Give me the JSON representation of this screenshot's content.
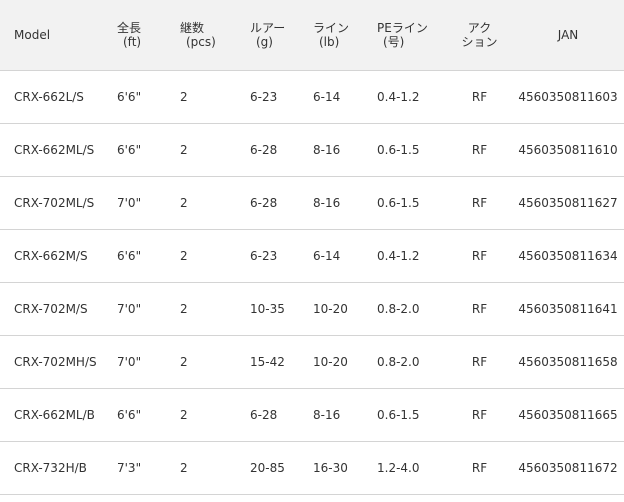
{
  "table": {
    "headers": [
      {
        "line1": "Model",
        "line2": ""
      },
      {
        "line1": "全長",
        "line2": "(ft)"
      },
      {
        "line1": "継数",
        "line2": "(pcs)"
      },
      {
        "line1": "ルアー",
        "line2": "(g)"
      },
      {
        "line1": "ライン",
        "line2": "(lb)"
      },
      {
        "line1": "PEライン",
        "line2": "(号)"
      },
      {
        "line1": "アク",
        "line2": "ション"
      },
      {
        "line1": "JAN",
        "line2": ""
      }
    ],
    "rows": [
      [
        "CRX-662L/S",
        "6'6\"",
        "2",
        "6-23",
        "6-14",
        "0.4-1.2",
        "RF",
        "4560350811603"
      ],
      [
        "CRX-662ML/S",
        "6'6\"",
        "2",
        "6-28",
        "8-16",
        "0.6-1.5",
        "RF",
        "4560350811610"
      ],
      [
        "CRX-702ML/S",
        "7'0\"",
        "2",
        "6-28",
        "8-16",
        "0.6-1.5",
        "RF",
        "4560350811627"
      ],
      [
        "CRX-662M/S",
        "6'6\"",
        "2",
        "6-23",
        "6-14",
        "0.4-1.2",
        "RF",
        "4560350811634"
      ],
      [
        "CRX-702M/S",
        "7'0\"",
        "2",
        "10-35",
        "10-20",
        "0.8-2.0",
        "RF",
        "4560350811641"
      ],
      [
        "CRX-702MH/S",
        "7'0\"",
        "2",
        "15-42",
        "10-20",
        "0.8-2.0",
        "RF",
        "4560350811658"
      ],
      [
        "CRX-662ML/B",
        "6'6\"",
        "2",
        "6-28",
        "8-16",
        "0.6-1.5",
        "RF",
        "4560350811665"
      ],
      [
        "CRX-732H/B",
        "7'3\"",
        "2",
        "20-85",
        "16-30",
        "1.2-4.0",
        "RF",
        "4560350811672"
      ]
    ]
  }
}
